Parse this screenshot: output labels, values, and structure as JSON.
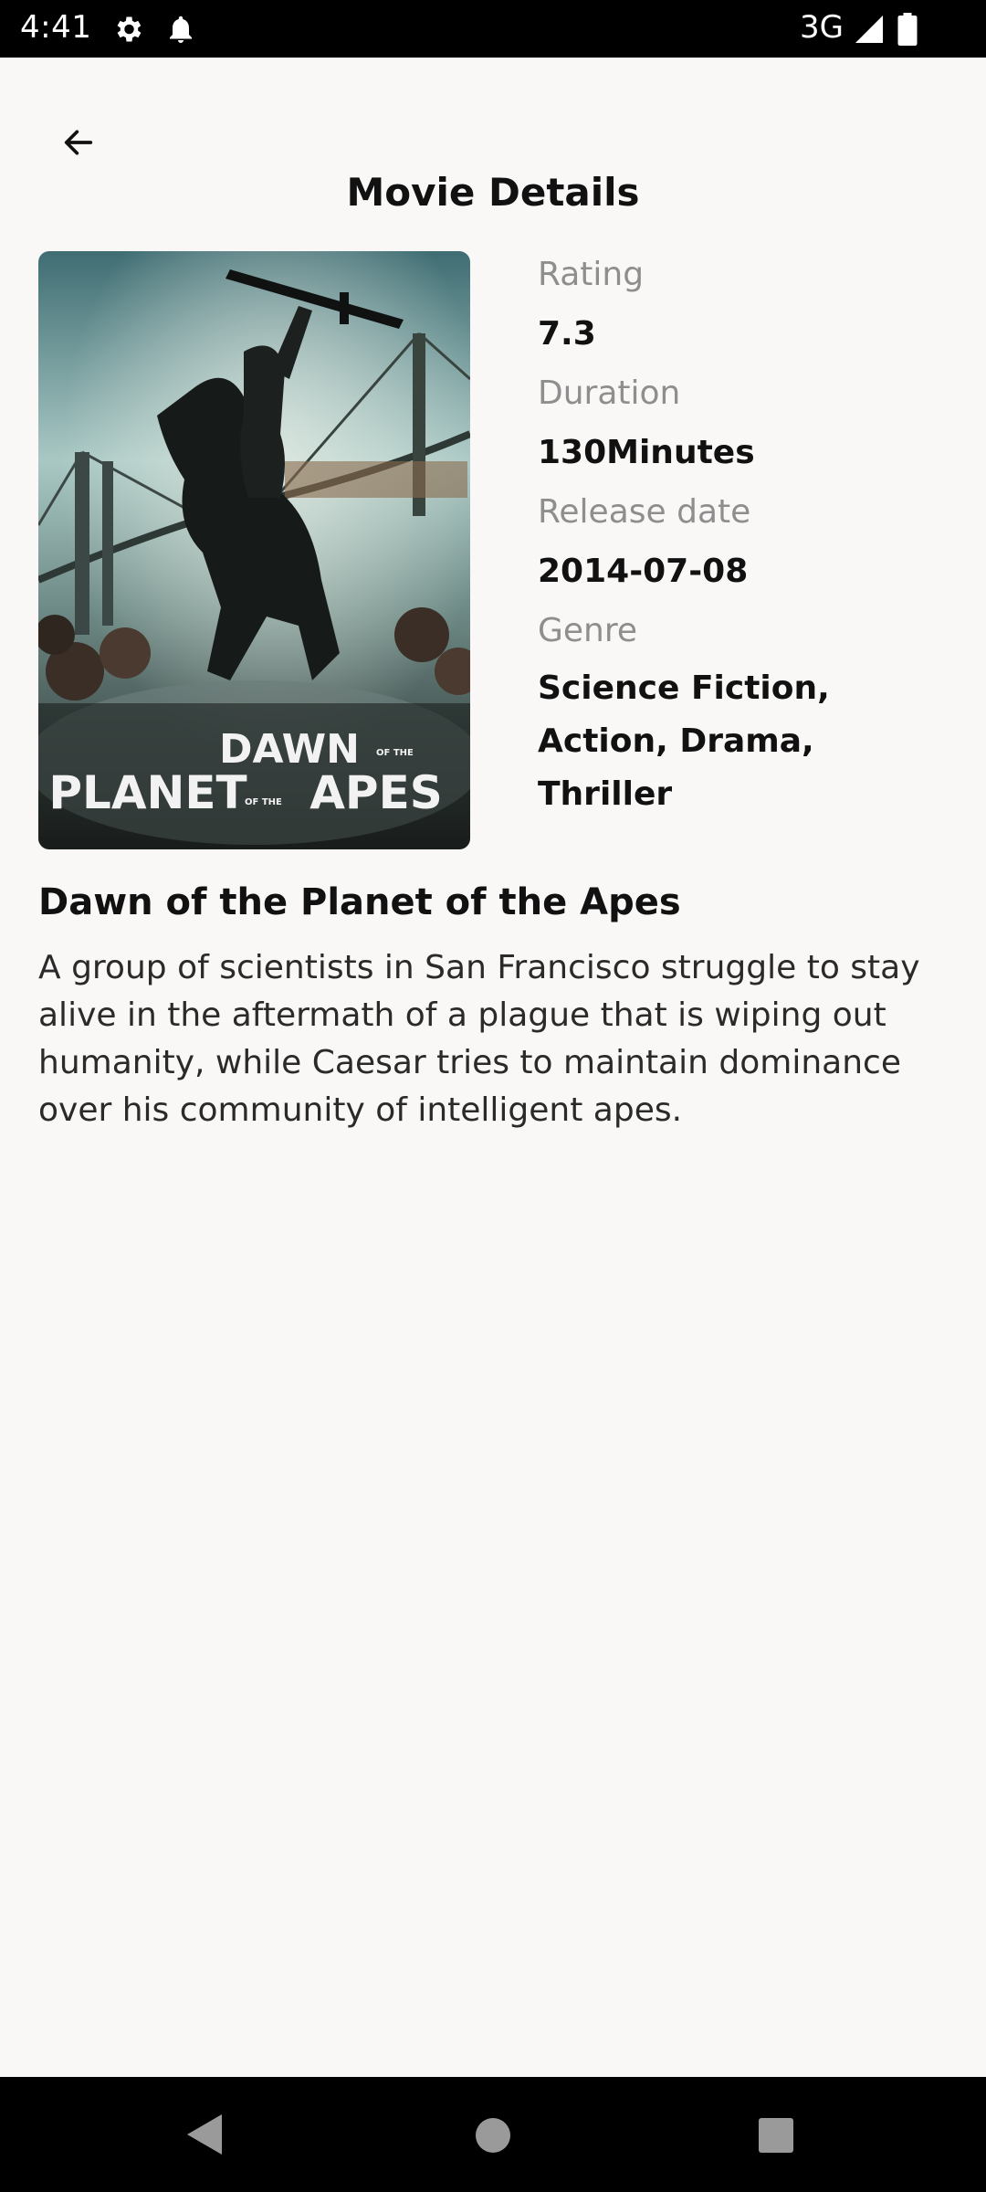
{
  "status_bar": {
    "time": "4:41",
    "network": "3G",
    "icons": [
      "gear-icon",
      "bell-icon",
      "signal-icon",
      "battery-icon"
    ]
  },
  "app_bar": {
    "title": "Movie Details",
    "back_icon": "arrow-left-icon"
  },
  "poster": {
    "title_line1": "DAWN",
    "title_line2": "PLANET",
    "title_line3": "APES",
    "of_the": "OF THE"
  },
  "details": {
    "rating_label": "Rating",
    "rating_value": "7.3",
    "duration_label": "Duration",
    "duration_value": "130Minutes",
    "release_label": "Release date",
    "release_value": "2014-07-08",
    "genre_label": "Genre",
    "genre_value": "Science Fiction, Action, Drama, Thriller"
  },
  "movie": {
    "title": "Dawn of the Planet of the Apes",
    "overview": "A group of scientists in San Francisco struggle to stay alive in the aftermath of a plague that is wiping out humanity, while Caesar tries to maintain dominance over his community of intelligent apes."
  },
  "nav_bar": {
    "icons": [
      "back-triangle-icon",
      "home-circle-icon",
      "recents-square-icon"
    ]
  },
  "colors": {
    "background": "#faf8f6",
    "label_gray": "#8e8e8e",
    "text_dark": "#111111"
  }
}
